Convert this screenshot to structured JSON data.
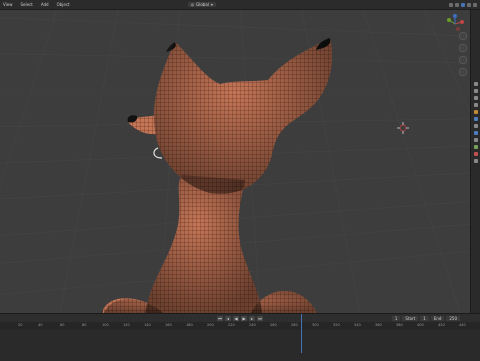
{
  "app": {
    "title": "Blender"
  },
  "topbar": {
    "menus": [
      "View",
      "Select",
      "Add",
      "Object"
    ],
    "mode": "Object",
    "view": "Global"
  },
  "sidebar": {
    "icons": [
      "tool-icon",
      "item-icon",
      "view-icon",
      "edit-icon",
      "properties-icon",
      "modifier-icon",
      "particles-icon",
      "physics-icon",
      "constraints-icon",
      "data-icon",
      "material-icon",
      "texture-icon"
    ]
  },
  "timeline": {
    "playback_label": "Playback",
    "frame_ticks": [
      "20",
      "40",
      "60",
      "80",
      "100",
      "120",
      "140",
      "160",
      "180",
      "200",
      "220",
      "240",
      "260",
      "280",
      "300",
      "320",
      "340",
      "360",
      "380",
      "400",
      "420",
      "440"
    ],
    "current_frame": "1",
    "start_label": "Start",
    "end_label": "End",
    "start": "1",
    "end": "250"
  },
  "colors": {
    "skin": "#c8775a",
    "wire": "#4a1f12",
    "bg": "#3d3d3d",
    "accent": "#4772b3"
  }
}
